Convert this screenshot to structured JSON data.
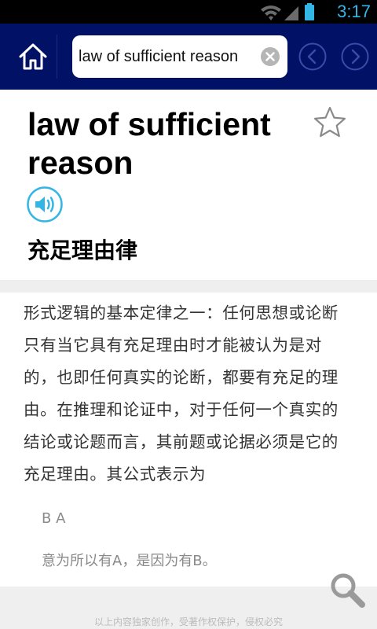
{
  "status_bar": {
    "time": "3:17",
    "accent_color": "#33b5e5"
  },
  "toolbar": {
    "background": "#001166",
    "search_value": "law of sufficient reason",
    "icons": [
      "home-icon",
      "clear-icon",
      "arrow-left-icon",
      "arrow-right-icon"
    ]
  },
  "entry": {
    "word": "law of sufficient reason",
    "translation": "充足理由律",
    "icons": [
      "star-icon",
      "speaker-icon"
    ]
  },
  "definition": {
    "text": "形式逻辑的基本定律之一：任何思想或论断只有当它具有充足理由时才能被认为是对的，也即任何真实的论断，都要有充足的理由。在推理和论证中，对于任何一个真实的结论或论题而言，其前题或论据必须是它的充足理由。其公式表示为",
    "formula": "B A",
    "explanation": "意为所以有A，是因为有B。"
  },
  "footer": {
    "copyright": "以上内容独家创作，受著作权保护，侵权必究"
  }
}
